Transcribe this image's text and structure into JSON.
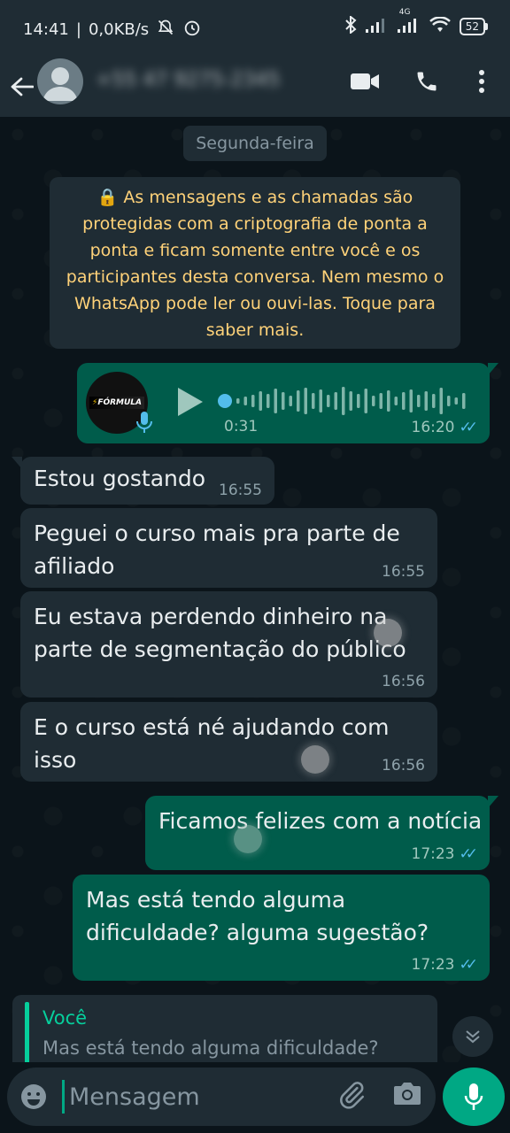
{
  "status_bar": {
    "time": "14:41",
    "speed": "0,0KB/s",
    "network": "4G",
    "battery": "52"
  },
  "header": {
    "contact_name": "+55 47 9275-2345",
    "icons": [
      "back-arrow-icon",
      "video-call-icon",
      "voice-call-icon",
      "more-options-icon"
    ]
  },
  "chat": {
    "date_label": "Segunda-feira",
    "encryption_notice": "🔒 As mensagens e as chamadas são protegidas com a criptografia de ponta a ponta e ficam somente entre você e os participantes desta conversa. Nem mesmo o WhatsApp pode ler ou ouvi-las. Toque para saber mais.",
    "audio_message": {
      "thumbnail_text": "FÓRMULA",
      "duration": "0:31",
      "time": "16:20",
      "status": "read"
    },
    "messages": [
      {
        "direction": "in",
        "text": "Estou gostando",
        "time": "16:55"
      },
      {
        "direction": "in",
        "text": "Peguei o curso mais pra parte de afiliado",
        "time": "16:55"
      },
      {
        "direction": "in",
        "text": "Eu estava perdendo dinheiro na parte de segmentação do público",
        "time": "16:56"
      },
      {
        "direction": "in",
        "text": "E o curso está né ajudando com isso",
        "time": "16:56"
      },
      {
        "direction": "out",
        "text": "Ficamos felizes com a notícia",
        "time": "17:23",
        "status": "read"
      },
      {
        "direction": "out",
        "text": "Mas está tendo alguma dificuldade? alguma sugestão?",
        "time": "17:23",
        "status": "read"
      }
    ]
  },
  "reply_preview": {
    "author": "Você",
    "text": "Mas está tendo alguma dificuldade?"
  },
  "input": {
    "placeholder": "Mensagem",
    "value": ""
  },
  "colors": {
    "background": "#0b141a",
    "incoming_bubble": "#1f2c34",
    "outgoing_bubble": "#005c4b",
    "accent": "#00a884",
    "read_ticks": "#53bdeb",
    "encryption_text": "#ffd279"
  }
}
